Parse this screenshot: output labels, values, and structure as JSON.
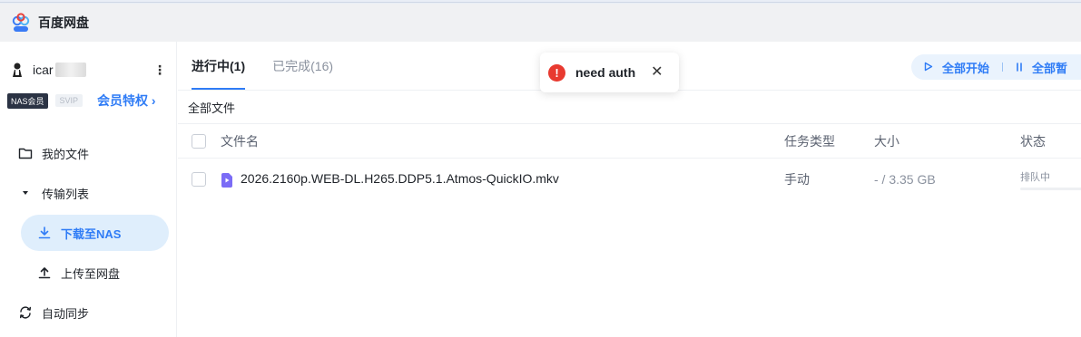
{
  "app": {
    "title": "百度网盘"
  },
  "user": {
    "name": "icar",
    "more": "⋮",
    "badge_nas": "NAS会员",
    "badge_svip": "SVIP",
    "vip_link": "会员特权 ›"
  },
  "sidebar": {
    "items": [
      {
        "label": "我的文件",
        "icon": "folder-icon"
      },
      {
        "label": "传输列表",
        "icon": "triangle-down-icon"
      },
      {
        "label": "下载至NAS",
        "icon": "download-icon",
        "active": true
      },
      {
        "label": "上传至网盘",
        "icon": "upload-icon"
      },
      {
        "label": "自动同步",
        "icon": "sync-icon"
      }
    ]
  },
  "tabs": [
    {
      "label": "进行中(1)",
      "active": true
    },
    {
      "label": "已完成(16)",
      "active": false
    }
  ],
  "actions": {
    "start_all": "全部开始",
    "pause_all": "全部暂"
  },
  "breadcrumb": "全部文件",
  "table": {
    "headers": {
      "name": "文件名",
      "type": "任务类型",
      "size": "大小",
      "status": "状态"
    },
    "rows": [
      {
        "name": "2026.2160p.WEB-DL.H265.DDP5.1.Atmos-QuickIO.mkv",
        "type": "手动",
        "size": "- / 3.35 GB",
        "status": "排队中",
        "progress": 0
      }
    ]
  },
  "toast": {
    "message": "need auth",
    "close": "✕"
  },
  "colors": {
    "accent": "#2f7cf6",
    "error": "#e83a30",
    "active_bg": "#dfeefc"
  }
}
